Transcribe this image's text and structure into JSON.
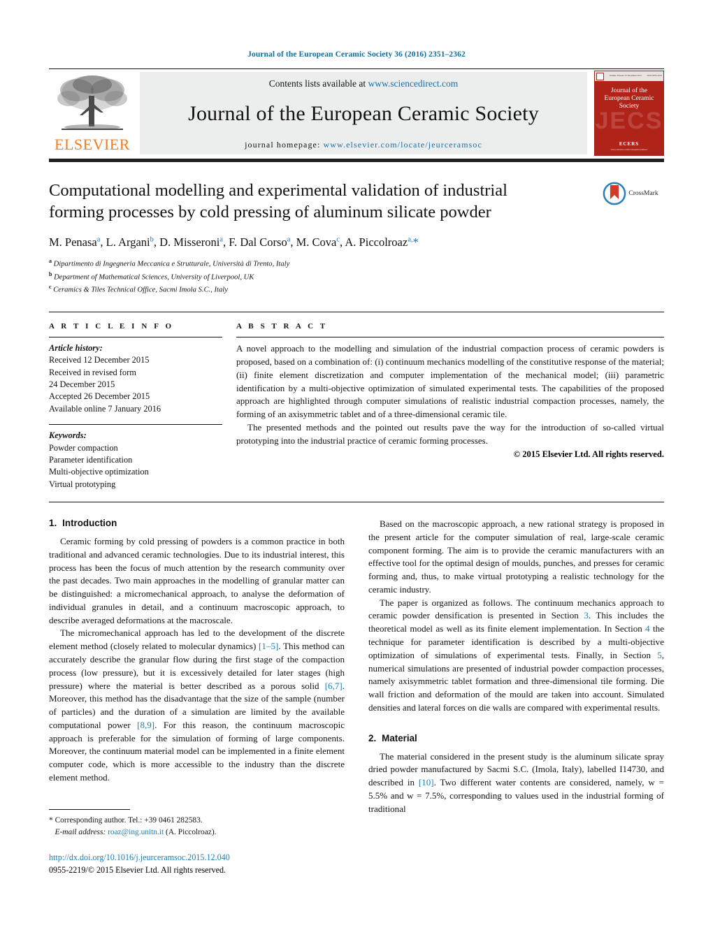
{
  "running_head": "Journal of the European Ceramic Society 36 (2016) 2351–2362",
  "masthead": {
    "contents_prefix": "Contents lists available at",
    "sciencedirect_url": "www.sciencedirect.com",
    "journal_title": "Journal of the European Ceramic Society",
    "homepage_prefix": "journal homepage:",
    "homepage_url": "www.elsevier.com/locate/jeurceramsoc",
    "publisher_name": "ELSEVIER",
    "publisher_logo_icon": "elsevier-tree-icon",
    "cover": {
      "title": "Journal of the\nEuropean Ceramic Society",
      "ghost_text": "JECS",
      "bottom_label": "ECERS",
      "bottom_sub": "www.elsevier.com/locate/jeurceramsoc"
    }
  },
  "article": {
    "title": "Computational modelling and experimental validation of industrial forming processes by cold pressing of aluminum silicate powder",
    "crossmark_label": "CrossMark",
    "authors_html": "M. Penasa<sup>a</sup>, L. Argani<sup>b</sup>, D. Misseroni<sup>a</sup>, F. Dal Corso<sup>a</sup>, M. Cova<sup>c</sup>, A. Piccolroaz<sup>a,</sup><span class=\"star\">*</span>",
    "affiliations": [
      {
        "marker": "a",
        "text": "Dipartimento di Ingegneria Meccanica e Strutturale, Università di Trento, Italy"
      },
      {
        "marker": "b",
        "text": "Department of Mathematical Sciences, University of Liverpool, UK"
      },
      {
        "marker": "c",
        "text": "Ceramics & Tiles Technical Office, Sacmi Imola S.C., Italy"
      }
    ]
  },
  "article_info": {
    "heading": "A R T I C L E   I N F O",
    "history_label": "Article history:",
    "history": [
      "Received 12 December 2015",
      "Received in revised form",
      "24 December 2015",
      "Accepted 26 December 2015",
      "Available online 7 January 2016"
    ],
    "keywords_label": "Keywords:",
    "keywords": [
      "Powder compaction",
      "Parameter identification",
      "Multi-objective optimization",
      "Virtual prototyping"
    ]
  },
  "abstract": {
    "heading": "A B S T R A C T",
    "paragraph1": "A novel approach to the modelling and simulation of the industrial compaction process of ceramic powders is proposed, based on a combination of: (i) continuum mechanics modelling of the constitutive response of the material; (ii) finite element discretization and computer implementation of the mechanical model; (iii) parametric identification by a multi-objective optimization of simulated experimental tests. The capabilities of the proposed approach are highlighted through computer simulations of realistic industrial compaction processes, namely, the forming of an axisymmetric tablet and of a three-dimensional ceramic tile.",
    "paragraph2": "The presented methods and the pointed out results pave the way for the introduction of so-called virtual prototyping into the industrial practice of ceramic forming processes.",
    "copyright": "© 2015 Elsevier Ltd. All rights reserved."
  },
  "body": {
    "section1": {
      "number": "1.",
      "title": "Introduction",
      "p1": "Ceramic forming by cold pressing of powders is a common practice in both traditional and advanced ceramic technologies. Due to its industrial interest, this process has been the focus of much attention by the research community over the past decades. Two main approaches in the modelling of granular matter can be distinguished: a micromechanical approach, to analyse the deformation of individual granules in detail, and a continuum macroscopic approach, to describe averaged deformations at the macroscale.",
      "p2_a": "The micromechanical approach has led to the development of the discrete element method (closely related to molecular dynamics) ",
      "p2_ref1": "[1–5]",
      "p2_b": ". This method can accurately describe the granular flow during the first stage of the compaction process (low pressure), but it is excessively detailed for later stages (high pressure) where the material is better described as a porous solid ",
      "p2_ref2": "[6,7]",
      "p2_c": ". Moreover, this method has the disadvantage that the size of the sample (number of particles) and the duration of a simulation are limited by the available computational power ",
      "p2_ref3": "[8,9]",
      "p2_d": ". For this reason, the continuum macroscopic approach is preferable for the simulation of forming of large components. Moreover, the continuum material model can be implemented in a finite element computer code, which is more accessible to the industry than the discrete element method."
    },
    "right_column": {
      "p1": "Based on the macroscopic approach, a new rational strategy is proposed in the present article for the computer simulation of real, large-scale ceramic component forming. The aim is to provide the ceramic manufacturers with an effective tool for the optimal design of moulds, punches, and presses for ceramic forming and, thus, to make virtual prototyping a realistic technology for the ceramic industry.",
      "p2_a": "The paper is organized as follows. The continuum mechanics approach to ceramic powder densification is presented in Section ",
      "p2_ref_sec3": "3",
      "p2_b": ". This includes the theoretical model as well as its finite element implementation. In Section ",
      "p2_ref_sec4": "4",
      "p2_c": " the technique for parameter identification is described by a multi-objective optimization of simulations of experimental tests. Finally, in Section ",
      "p2_ref_sec5": "5",
      "p2_d": ", numerical simulations are presented of industrial powder compaction processes, namely axisymmetric tablet formation and three-dimensional tile forming. Die wall friction and deformation of the mould are taken into account. Simulated densities and lateral forces on die walls are compared with experimental results."
    },
    "section2": {
      "number": "2.",
      "title": "Material",
      "p1_a": "The material considered in the present study is the aluminum silicate spray dried powder manufactured by Sacmi S.C. (Imola, Italy), labelled I14730, and described in ",
      "p1_ref": "[10]",
      "p1_b": ". Two different water contents are considered, namely, w = 5.5% and w = 7.5%, corresponding to values used in the industrial forming of traditional"
    }
  },
  "footnote": {
    "star": "*",
    "corresponding": "Corresponding author. Tel.: +39 0461 282583.",
    "email_label": "E-mail address:",
    "email": "roaz@ing.unitn.it",
    "email_suffix": "(A. Piccolroaz).",
    "doi_url": "http://dx.doi.org/10.1016/j.jeurceramsoc.2015.12.040",
    "issn_line": "0955-2219/© 2015 Elsevier Ltd. All rights reserved."
  },
  "colors": {
    "link": "#1a7fb5",
    "elsevier_orange": "#F47C20",
    "cover_red": "#b02318",
    "running_head": "#0f6e9e"
  }
}
